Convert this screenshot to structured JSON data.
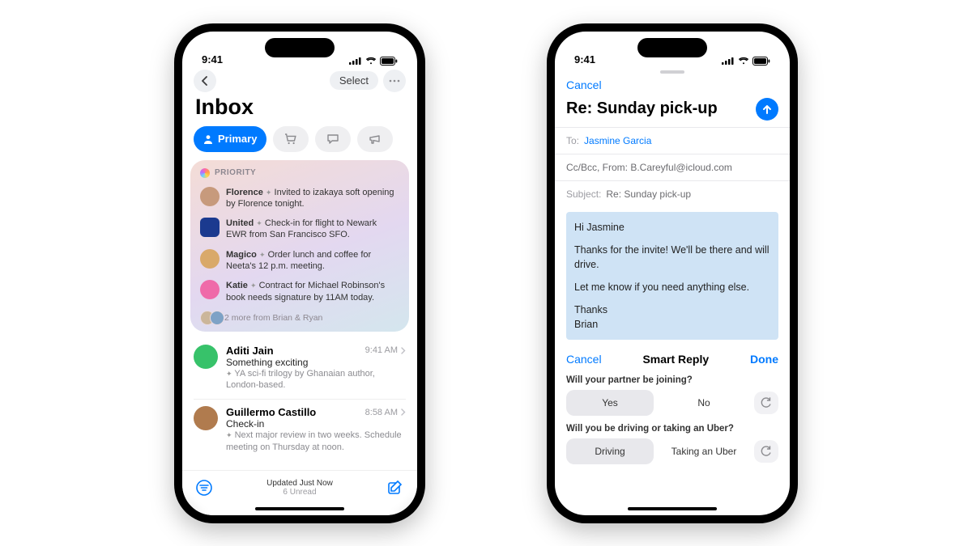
{
  "statusbar": {
    "time": "9:41"
  },
  "phone1": {
    "nav": {
      "select": "Select"
    },
    "title": "Inbox",
    "tabs": {
      "primary": "Primary",
      "icons": [
        "cart-icon",
        "chat-icon",
        "megaphone-icon"
      ]
    },
    "priority": {
      "label": "PRIORITY",
      "items": [
        {
          "sender": "Florence",
          "summary": "Invited to izakaya soft opening by Florence tonight.",
          "avatar_bg": "#c79a7c"
        },
        {
          "sender": "United",
          "summary": "Check-in for flight to Newark EWR from San Francisco SFO.",
          "avatar_bg": "#1b3a8f",
          "square": true
        },
        {
          "sender": "Magico",
          "summary": "Order lunch and coffee for Neeta's 12 p.m. meeting.",
          "avatar_bg": "#d9a96a"
        },
        {
          "sender": "Katie",
          "summary": "Contract for Michael Robinson's book needs signature by 11AM today.",
          "avatar_bg": "#ef6aa9"
        }
      ],
      "more": "2 more from Brian & Ryan"
    },
    "messages": [
      {
        "name": "Aditi Jain",
        "subject": "Something exciting",
        "preview": "YA sci-fi trilogy by Ghanaian author, London-based.",
        "time": "9:41 AM",
        "avatar_bg": "#37c26a"
      },
      {
        "name": "Guillermo Castillo",
        "subject": "Check-in",
        "preview": "Next major review in two weeks. Schedule meeting on Thursday at noon.",
        "time": "8:58 AM",
        "avatar_bg": "#b07b4e"
      }
    ],
    "footer": {
      "status": "Updated Just Now",
      "unread": "6 Unread"
    }
  },
  "phone2": {
    "cancel": "Cancel",
    "subject_title": "Re: Sunday pick-up",
    "to_label": "To:",
    "to_value": "Jasmine Garcia",
    "ccfrom": "Cc/Bcc, From:  B.Careyful@icloud.com",
    "subject_label": "Subject:",
    "subject_value": "Re: Sunday pick-up",
    "body": {
      "l1": "Hi Jasmine",
      "l2": "Thanks for the invite! We'll be there and will drive.",
      "l3": "Let me know if you need anything else.",
      "l4": "Thanks",
      "l5": "Brian"
    },
    "smartreply": {
      "cancel": "Cancel",
      "title": "Smart Reply",
      "done": "Done",
      "q1": "Will your partner be joining?",
      "q1a": "Yes",
      "q1b": "No",
      "q2": "Will you be driving or taking an Uber?",
      "q2a": "Driving",
      "q2b": "Taking an Uber"
    }
  }
}
